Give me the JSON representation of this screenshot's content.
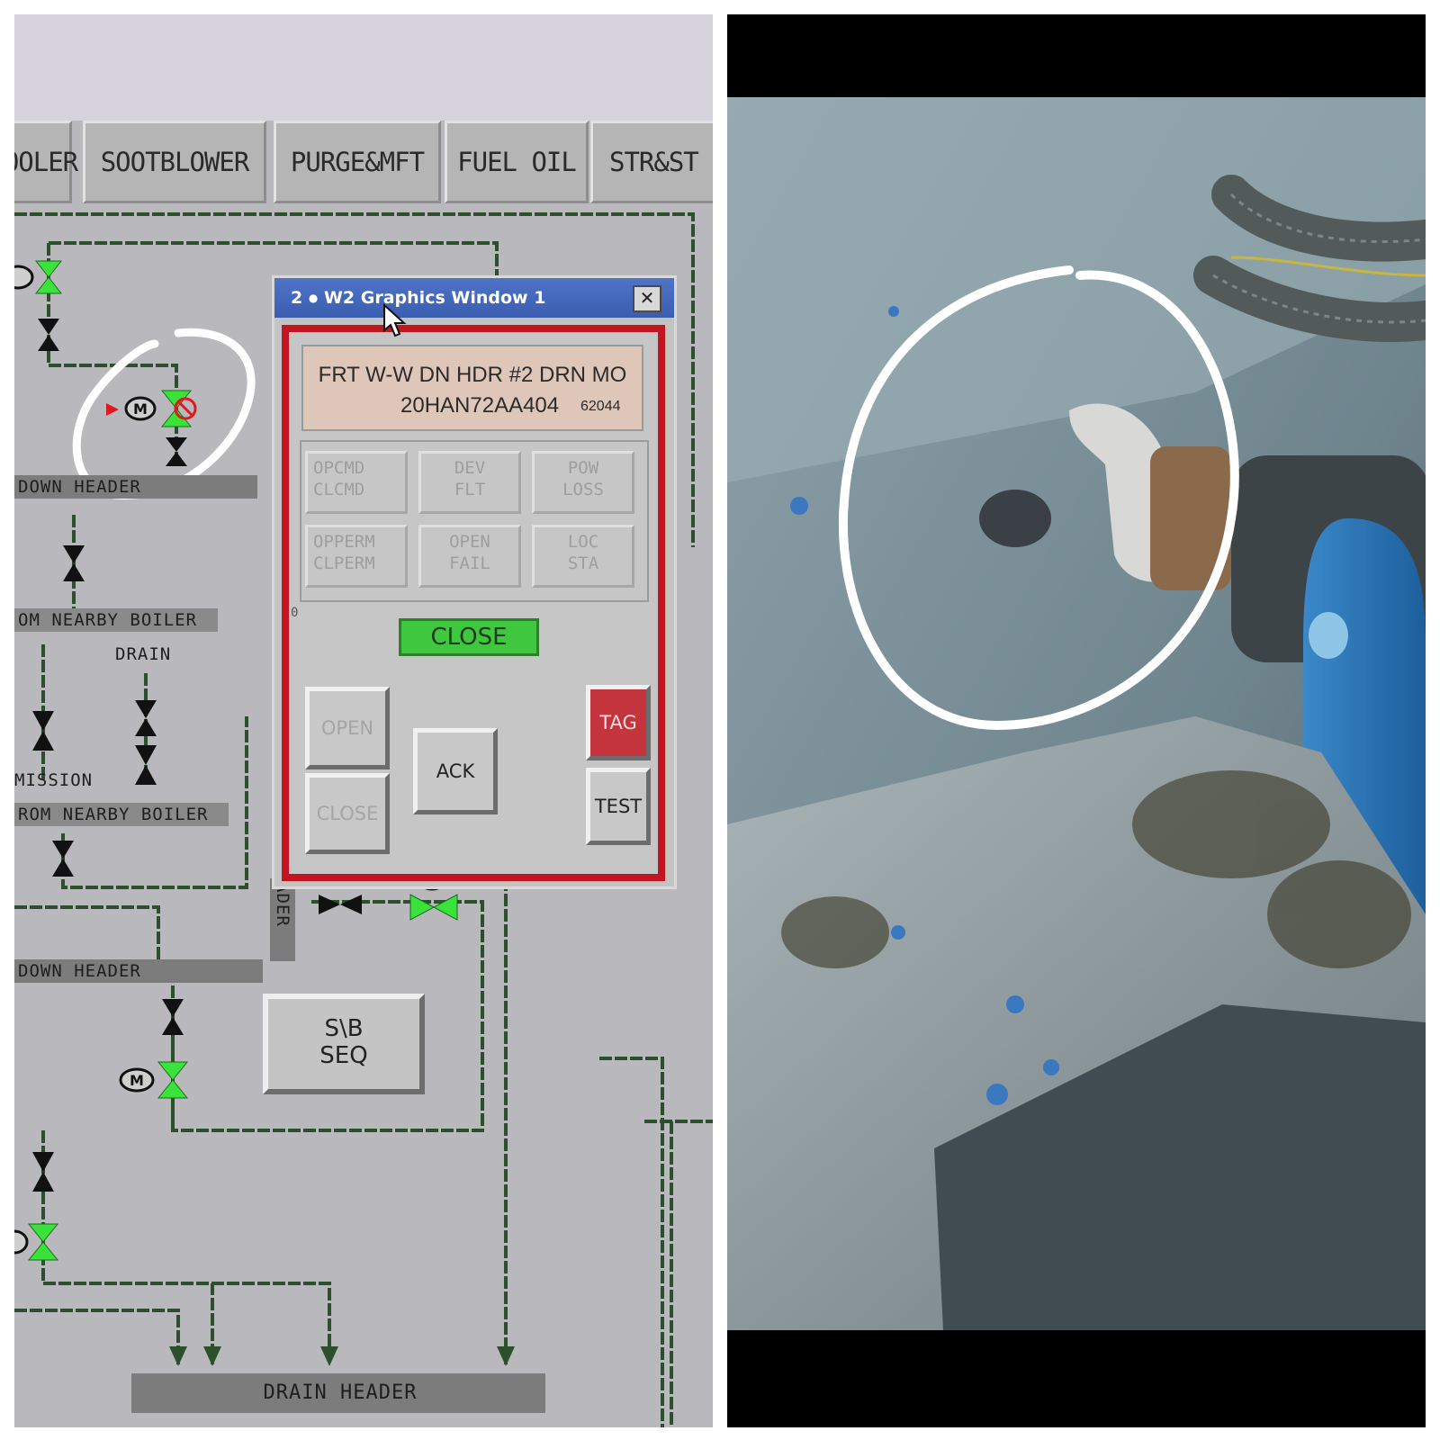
{
  "tabs": [
    "OOLER",
    "SOOTBLOWER",
    "PURGE&MFT",
    "FUEL OIL",
    "STR&ST"
  ],
  "schematic_labels": {
    "down_header_1": "DOWN  HEADER",
    "nearby_boiler_1": "OM NEARBY BOILER",
    "drain": "DRAIN",
    "mission": "MISSION",
    "nearby_boiler_2": "ROM NEARBY BOILER",
    "down_header_2": "DOWN  HEADER",
    "header_vertical": "ADER",
    "drain_header": "DRAIN  HEADER",
    "motor": "M"
  },
  "popup": {
    "title": "W2 Graphics Window 1",
    "title_index": "2",
    "close_glyph": "✕",
    "description": "FRT W-W DN HDR #2 DRN MO",
    "tag_id": "20HAN72AA404",
    "point_no": "62044",
    "status_boxes": [
      {
        "line1": "OPCMD",
        "line2": "CLCMD"
      },
      {
        "line1": "DEV",
        "line2": "FLT"
      },
      {
        "line1": "POW",
        "line2": "LOSS"
      },
      {
        "line1": "OPPERM",
        "line2": "CLPERM"
      },
      {
        "line1": "OPEN",
        "line2": "FAIL"
      },
      {
        "line1": "LOC",
        "line2": "STA"
      }
    ],
    "zero_label": "0",
    "state": "CLOSE",
    "buttons": {
      "open": "OPEN",
      "close": "CLOSE",
      "ack": "ACK",
      "tag": "TAG",
      "test": "TEST"
    }
  },
  "sb_seq": {
    "line1": "S\\B",
    "line2": "SEQ"
  },
  "colors": {
    "valve_open": "#39e339",
    "valve_closed": "#111111",
    "alarm": "#c2151f",
    "annotation": "#ffffff"
  }
}
